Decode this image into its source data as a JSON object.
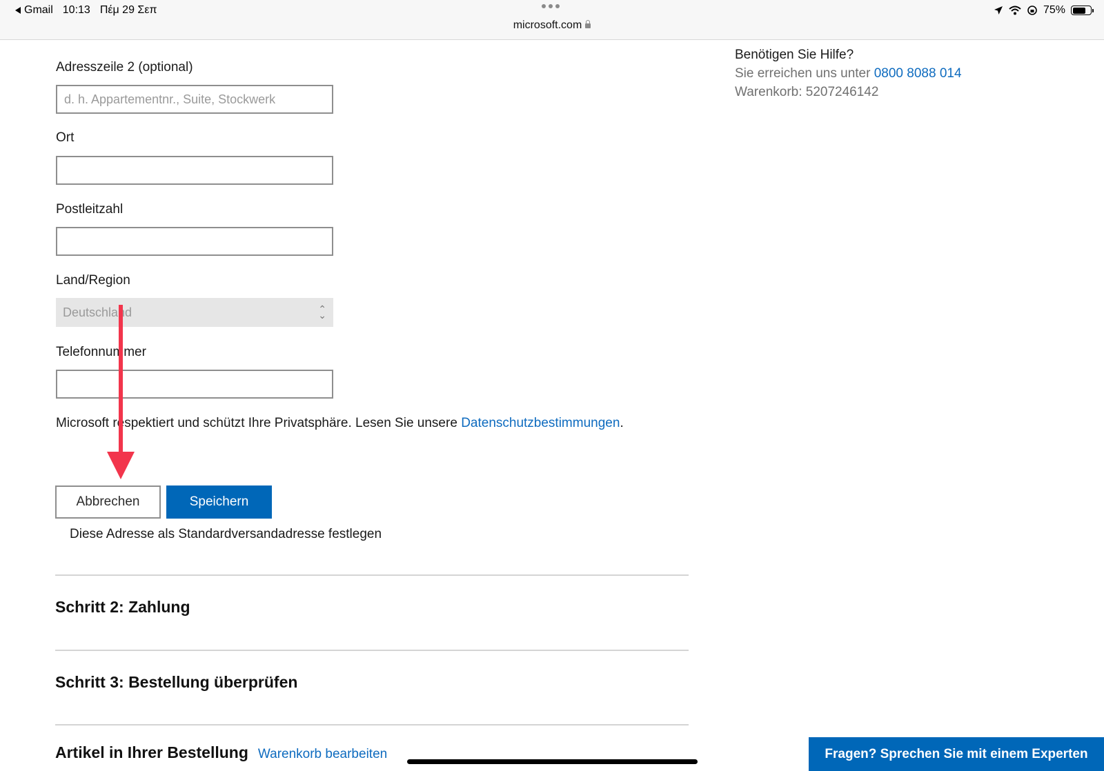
{
  "status_bar": {
    "back_app": "Gmail",
    "time": "10:13",
    "date": "Πέμ 29 Σεπ",
    "url": "microsoft.com",
    "battery": "75%"
  },
  "form": {
    "address2_label": "Adresszeile 2 (optional)",
    "address2_placeholder": "d. h. Appartementnr., Suite, Stockwerk",
    "city_label": "Ort",
    "postal_label": "Postleitzahl",
    "country_label": "Land/Region",
    "country_value": "Deutschland",
    "phone_label": "Telefonnummer",
    "privacy_text": "Microsoft respektiert und schützt Ihre Privatsphäre. Lesen Sie unsere ",
    "privacy_link": "Datenschutzbestimmungen",
    "privacy_end": ".",
    "cancel_label": "Abbrechen",
    "save_label": "Speichern",
    "default_address_text": "Diese Adresse als Standardversandadresse festlegen"
  },
  "steps": {
    "step2": "Schritt 2: Zahlung",
    "step3": "Schritt 3: Bestellung überprüfen",
    "articles": "Artikel in Ihrer Bestellung",
    "edit_cart": "Warenkorb bearbeiten"
  },
  "help": {
    "title": "Benötigen Sie Hilfe?",
    "reach_text": "Sie erreichen uns unter ",
    "phone": "0800 8088 014",
    "cart_text": "Warenkorb: 5207246142"
  },
  "expert_button": "Fragen? Sprechen Sie mit einem Experten",
  "colors": {
    "accent": "#0067b8",
    "link": "#0e6bbf",
    "annotation_arrow": "#f2354c"
  }
}
